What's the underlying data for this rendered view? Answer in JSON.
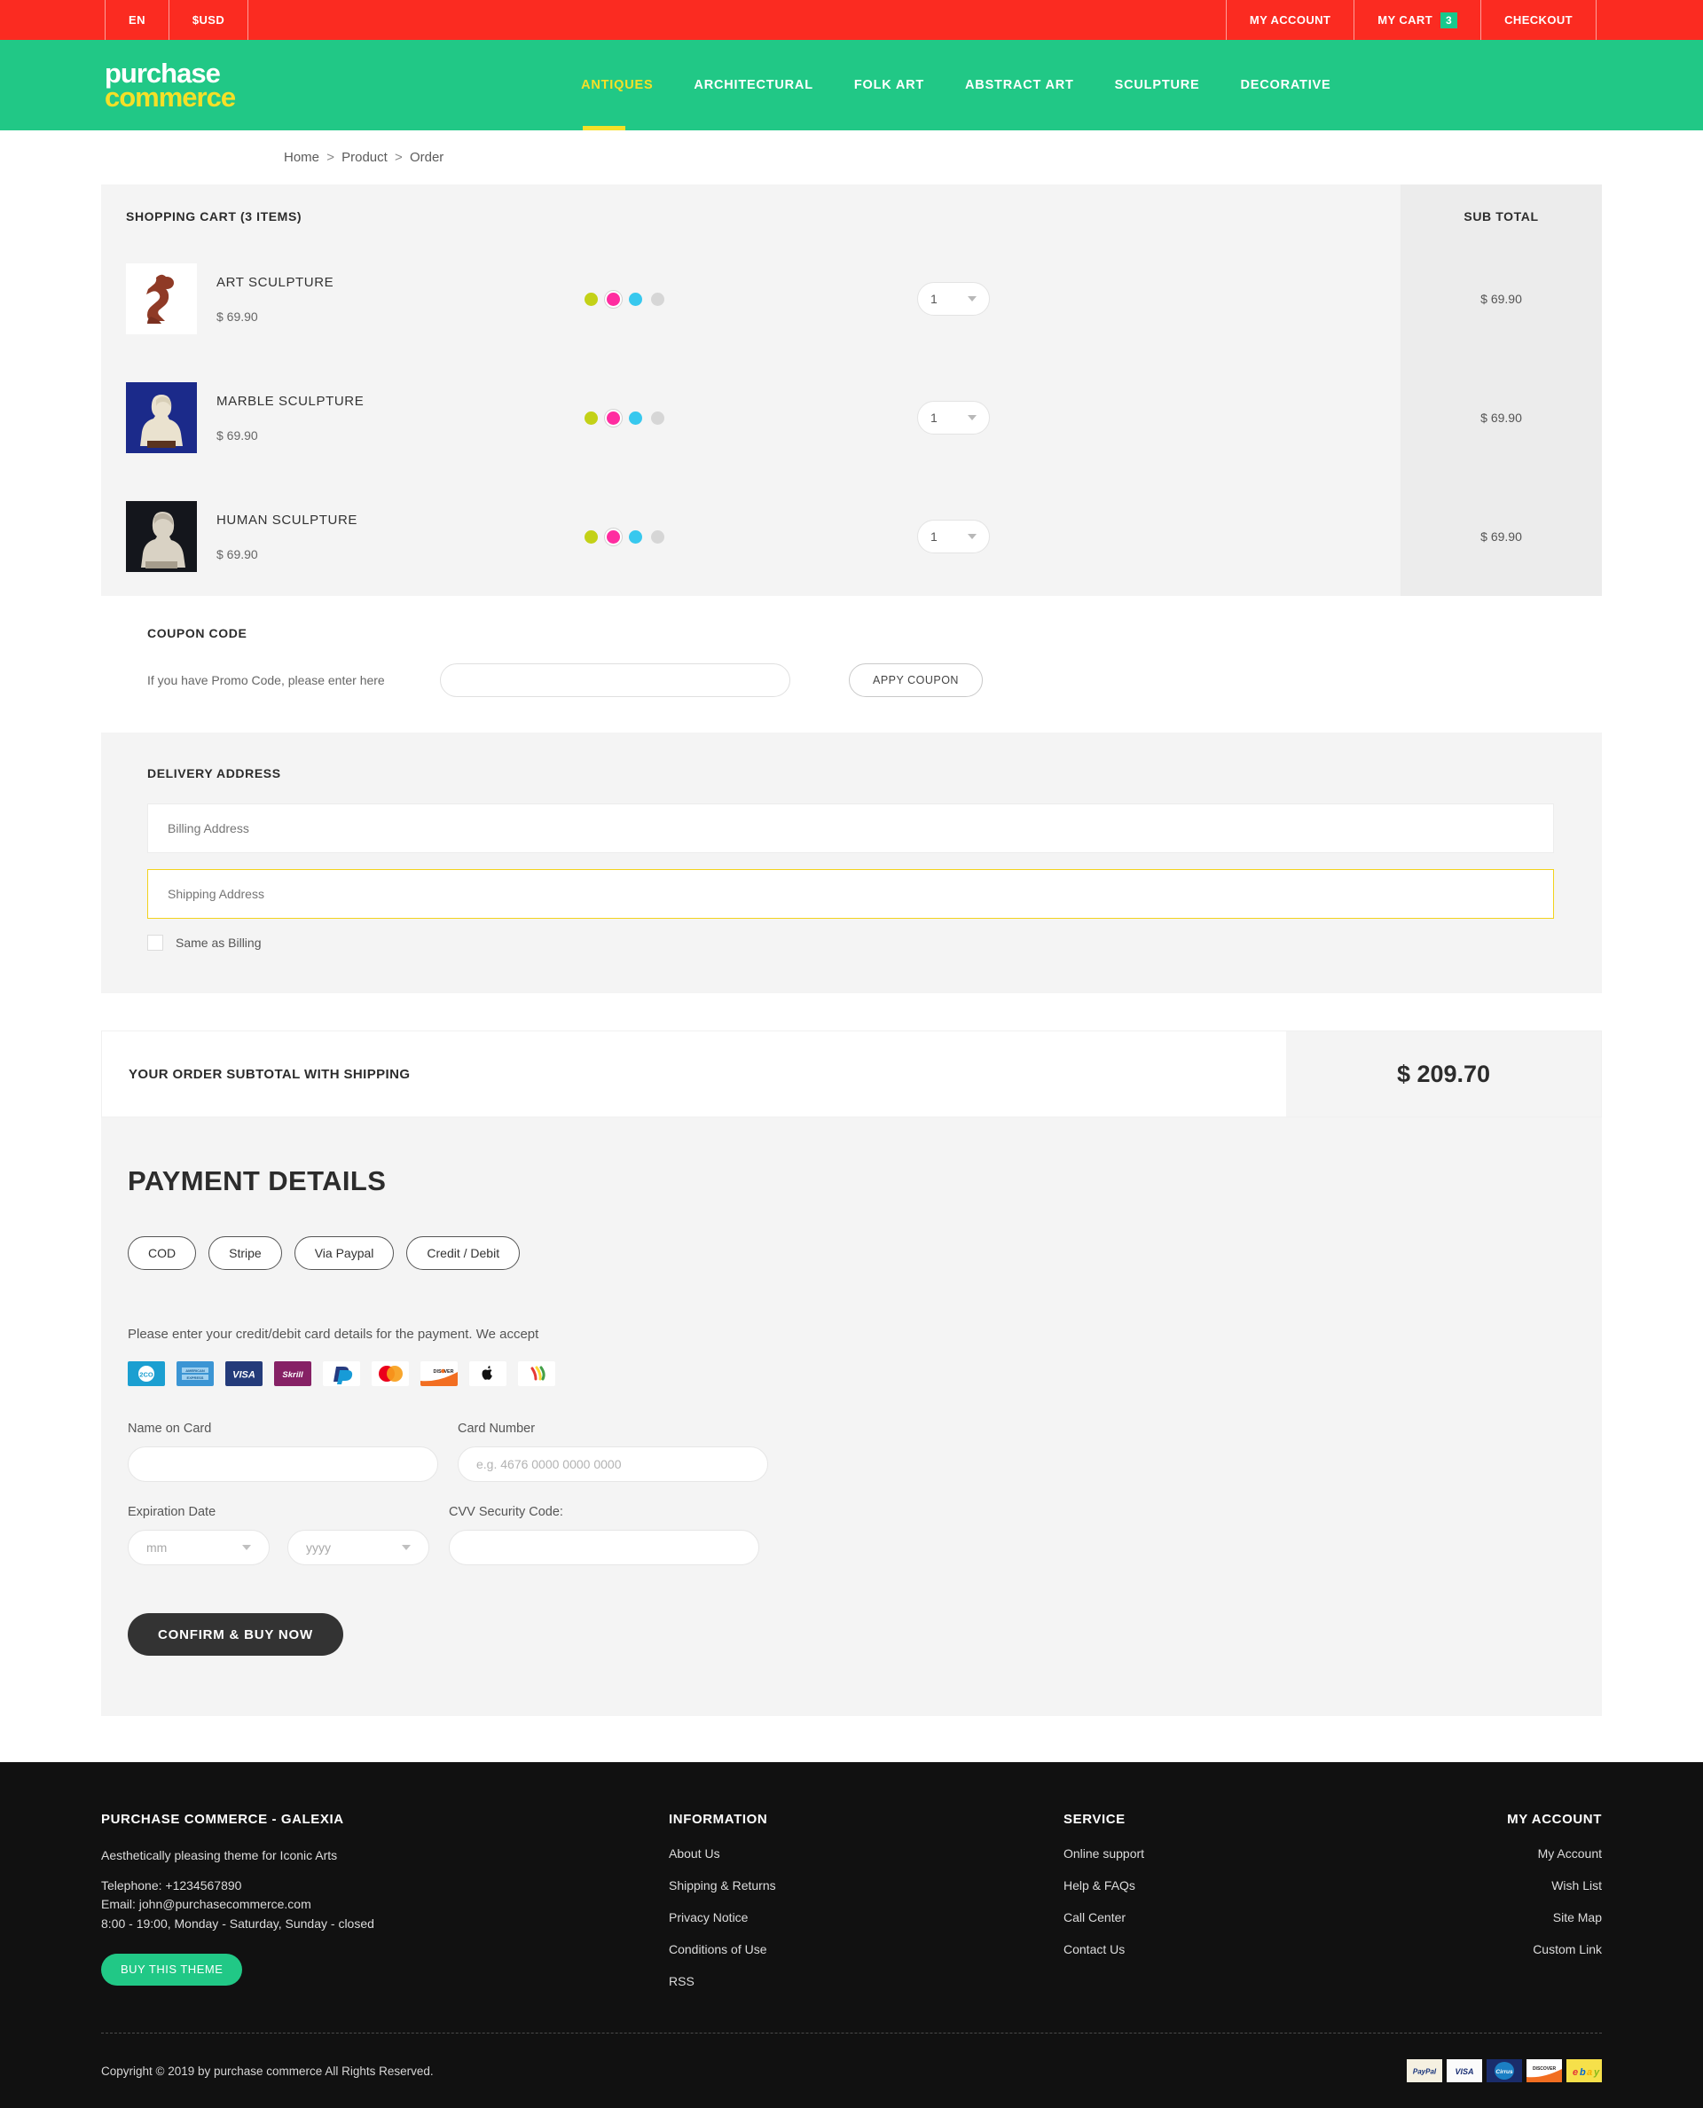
{
  "topbar": {
    "language": "EN",
    "currency": "$USD",
    "my_account": "MY ACCOUNT",
    "my_cart": "MY CART",
    "cart_count": "3",
    "checkout": "CHECKOUT"
  },
  "brand": {
    "line1": "purchase",
    "line2": "commerce"
  },
  "nav": [
    {
      "label": "ANTIQUES",
      "active": true
    },
    {
      "label": "ARCHITECTURAL",
      "active": false
    },
    {
      "label": "FOLK ART",
      "active": false
    },
    {
      "label": "ABSTRACT ART",
      "active": false
    },
    {
      "label": "SCULPTURE",
      "active": false
    },
    {
      "label": "DECORATIVE",
      "active": false
    }
  ],
  "breadcrumb": {
    "home": "Home",
    "product": "Product",
    "order": "Order",
    "sep": ">"
  },
  "cart": {
    "title": "SHOPPING CART (3 ITEMS)",
    "subtotal_header": "SUB TOTAL",
    "items": [
      {
        "name": "ART SCULPTURE",
        "price": "$ 69.90",
        "qty": "1",
        "subtotal": "$ 69.90",
        "thumb": "art-sculpture-thumb"
      },
      {
        "name": "MARBLE SCULPTURE",
        "price": "$ 69.90",
        "qty": "1",
        "subtotal": "$ 69.90",
        "thumb": "marble-sculpture-thumb"
      },
      {
        "name": "HUMAN SCULPTURE",
        "price": "$ 69.90",
        "qty": "1",
        "subtotal": "$ 69.90",
        "thumb": "human-sculpture-thumb"
      }
    ],
    "swatch_colors": [
      "#c3d117",
      "#ff2ca0",
      "#37c8ee",
      "#d6d6d6"
    ],
    "selected_swatch_index": 1
  },
  "coupon": {
    "title": "COUPON CODE",
    "label": "If you have Promo Code, please enter here",
    "input_value": "",
    "input_placeholder": "",
    "button": "APPY COUPON"
  },
  "delivery": {
    "title": "DELIVERY ADDRESS",
    "billing_placeholder": "Billing Address",
    "billing_value": "",
    "shipping_placeholder": "Shipping Address",
    "shipping_value": "",
    "same_as_billing": "Same as Billing"
  },
  "order_total": {
    "label": "YOUR ORDER SUBTOTAL WITH SHIPPING",
    "amount": "$ 209.70"
  },
  "payment": {
    "heading": "PAYMENT DETAILS",
    "tabs": [
      {
        "label": "COD"
      },
      {
        "label": "Stripe"
      },
      {
        "label": "Via Paypal"
      },
      {
        "label": "Credit / Debit"
      }
    ],
    "note": "Please enter your credit/debit card details for the payment. We accept",
    "card_logos": [
      "2co-icon",
      "american-express-icon",
      "visa-icon",
      "skrill-icon",
      "paypal-icon",
      "mastercard-icon",
      "discover-icon",
      "apple-pay-icon",
      "wallet-icon"
    ],
    "fields": {
      "name_label": "Name on Card",
      "name_value": "",
      "name_placeholder": "",
      "card_label": "Card Number",
      "card_value": "",
      "card_placeholder": "e.g. 4676 0000 0000 0000",
      "exp_label": "Expiration Date",
      "exp_month": "mm",
      "exp_year": "yyyy",
      "cvv_label": "CVV Security Code:",
      "cvv_value": "",
      "cvv_placeholder": ""
    },
    "confirm_button": "CONFIRM & BUY NOW"
  },
  "footer": {
    "about": {
      "title": "PURCHASE COMMERCE - GALEXIA",
      "tagline": "Aesthetically pleasing theme for Iconic Arts",
      "telephone": "Telephone: +1234567890",
      "email": "Email: john@purchasecommerce.com",
      "hours": "8:00 - 19:00, Monday - Saturday, Sunday - closed",
      "buy_button": "BUY THIS THEME"
    },
    "information": {
      "title": "INFORMATION",
      "links": [
        "About Us",
        "Shipping & Returns",
        "Privacy Notice",
        "Conditions of Use",
        "RSS"
      ]
    },
    "service": {
      "title": "SERVICE",
      "links": [
        "Online support",
        "Help & FAQs",
        "Call Center",
        "Contact Us"
      ]
    },
    "my_account": {
      "title": "MY ACCOUNT",
      "links": [
        "My Account",
        "Wish List",
        "Site Map",
        "Custom Link"
      ]
    },
    "copyright": "Copyright © 2019 by purchase commerce All Rights Reserved.",
    "badges": [
      "paypal-badge",
      "visa-badge",
      "cirrus-badge",
      "discover-badge",
      "ebay-badge"
    ]
  },
  "colors": {
    "red": "#fb2b21",
    "green": "#21c886",
    "yellow": "#f5e027",
    "dark": "#333333",
    "footer_bg": "#111111"
  }
}
